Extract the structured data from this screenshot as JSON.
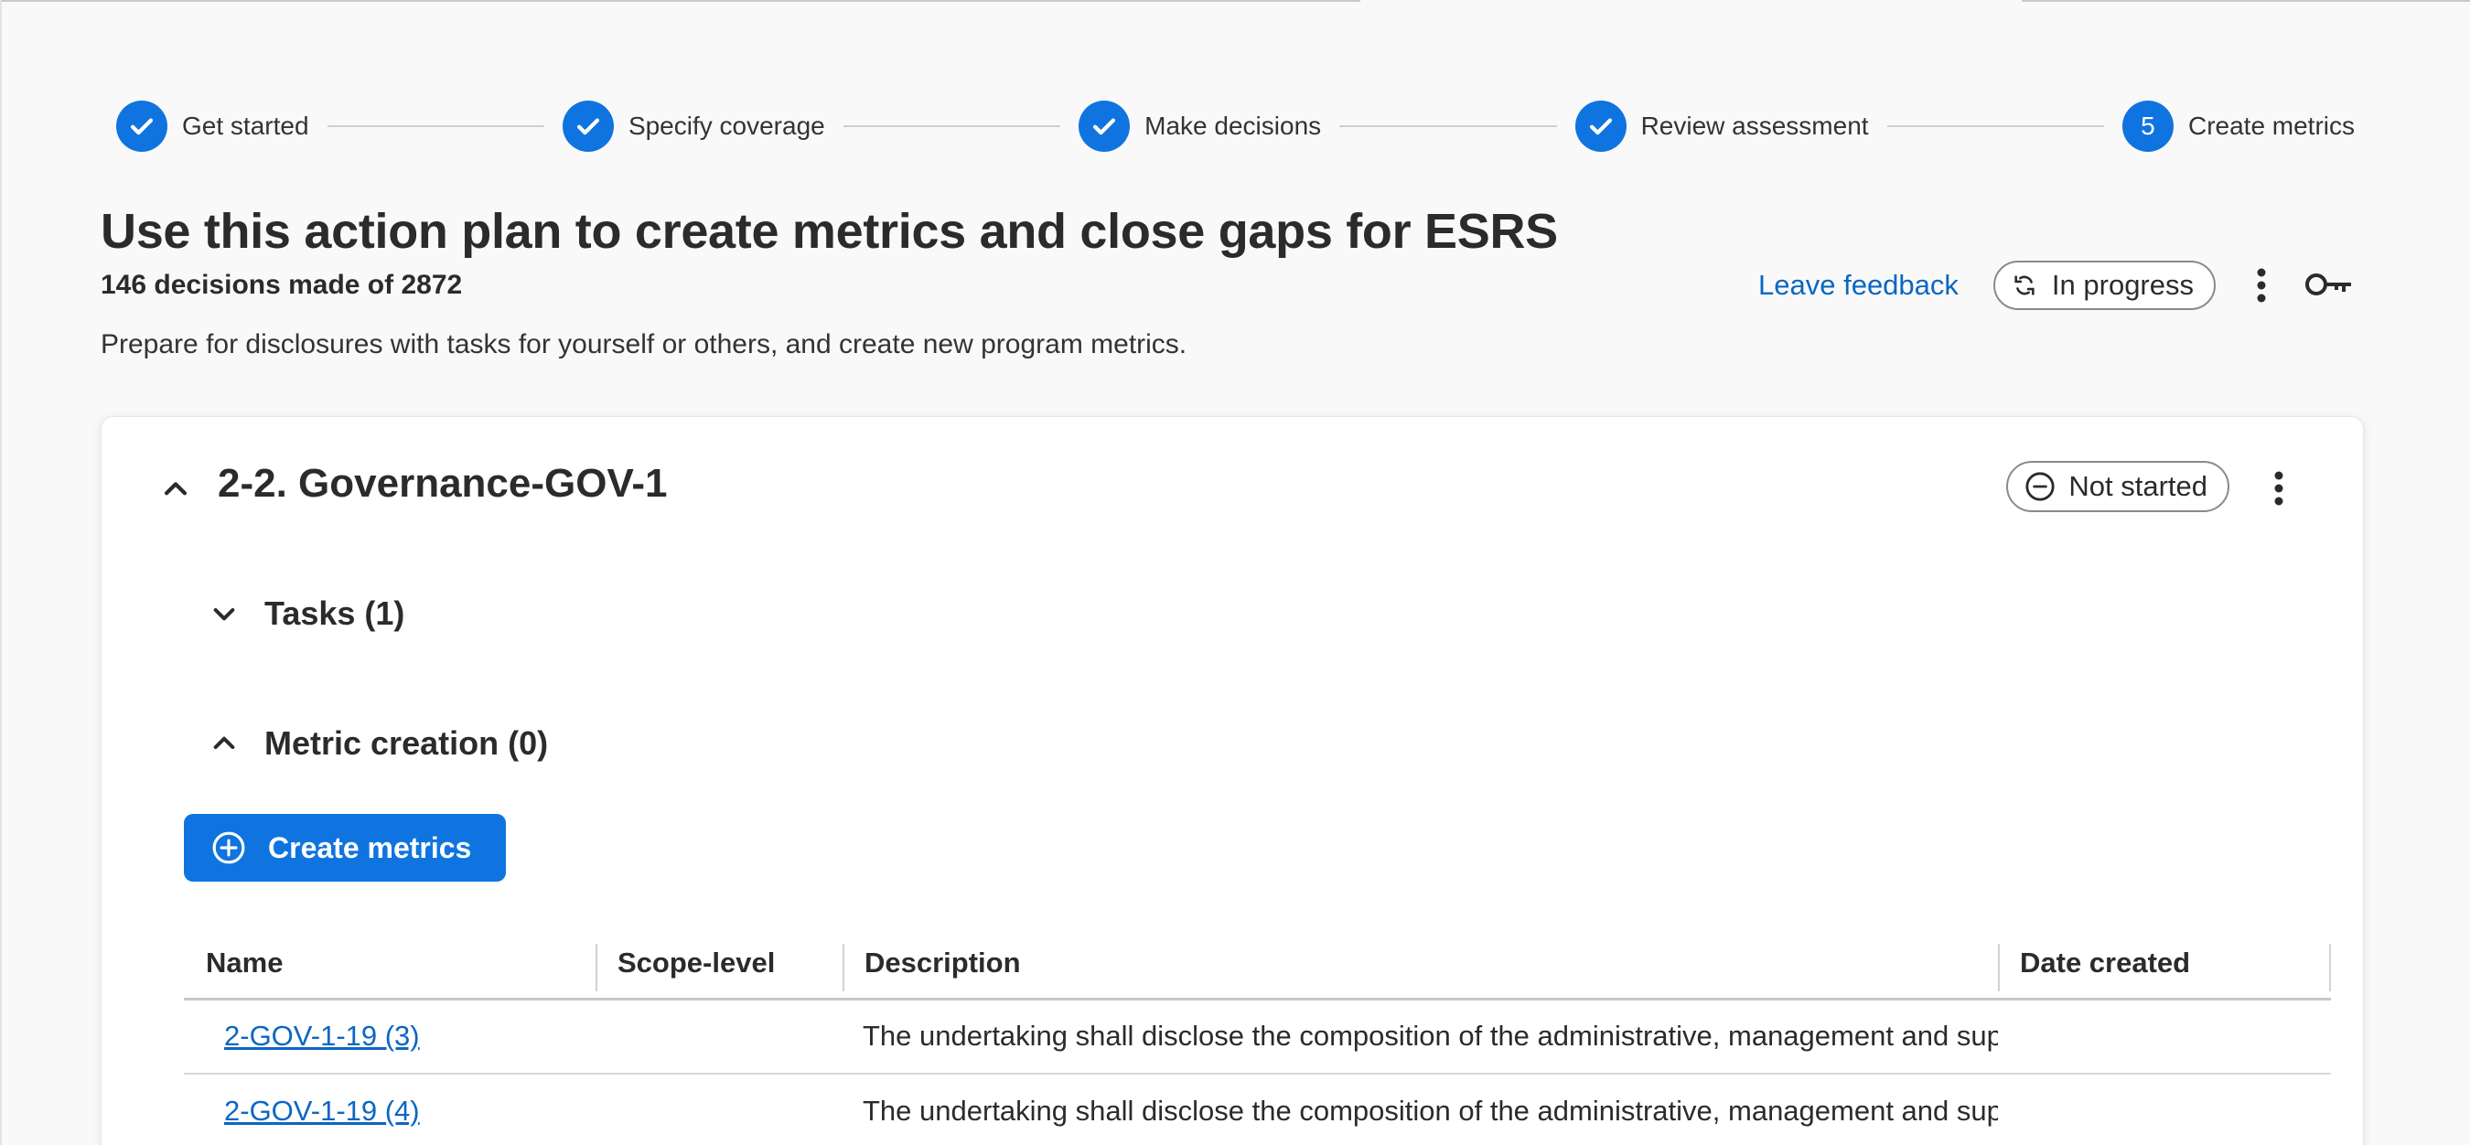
{
  "stepper": {
    "steps": [
      {
        "label": "Get started",
        "state": "complete",
        "icon": "check-icon"
      },
      {
        "label": "Specify coverage",
        "state": "complete",
        "icon": "check-icon"
      },
      {
        "label": "Make decisions",
        "state": "complete",
        "icon": "check-icon"
      },
      {
        "label": "Review assessment",
        "state": "complete",
        "icon": "check-icon"
      },
      {
        "label": "Create metrics",
        "state": "current",
        "number": "5"
      }
    ]
  },
  "header": {
    "title": "Use this action plan to create metrics and close gaps for ESRS",
    "decisions_count": "146 decisions made of 2872",
    "description": "Prepare for disclosures with tasks for yourself or others, and create new program metrics.",
    "feedback_link": "Leave feedback",
    "status": "In progress",
    "status_icon": "sync-icon",
    "menu_icon": "kebab-menu-icon",
    "key_icon": "key-icon"
  },
  "card": {
    "title": "2-2. Governance-GOV-1",
    "status": "Not started",
    "status_icon": "minus-circle-icon",
    "tasks_header": "Tasks (1)",
    "metric_creation_header": "Metric creation (0)",
    "create_button": "Create metrics",
    "table": {
      "columns": [
        "Name",
        "Scope-level",
        "Description",
        "Date created"
      ],
      "rows": [
        {
          "name": "2-GOV-1-19 (3)",
          "scope": "",
          "description": "The undertaking shall disclose the composition of the administrative, management and supervisory bodies",
          "date": ""
        },
        {
          "name": "2-GOV-1-19 (4)",
          "scope": "",
          "description": "The undertaking shall disclose the composition of the administrative, management and supervisory bodies",
          "date": ""
        }
      ]
    }
  },
  "colors": {
    "accent": "#0f74e0",
    "link": "#0b66c3",
    "text": "#2b2b2b",
    "background": "#f9f9f9"
  }
}
